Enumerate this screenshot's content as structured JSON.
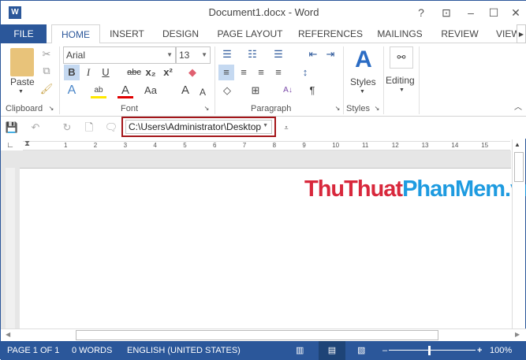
{
  "window": {
    "title": "Document1.docx - Word",
    "app_icon": "W"
  },
  "tabs": [
    {
      "label": "FILE"
    },
    {
      "label": "HOME"
    },
    {
      "label": "INSERT"
    },
    {
      "label": "DESIGN"
    },
    {
      "label": "PAGE LAYOUT"
    },
    {
      "label": "REFERENCES"
    },
    {
      "label": "MAILINGS"
    },
    {
      "label": "REVIEW"
    },
    {
      "label": "VIEW"
    }
  ],
  "ribbon": {
    "clipboard": {
      "label": "Clipboard",
      "paste": "Paste"
    },
    "font": {
      "label": "Font",
      "name": "Arial",
      "size": "13",
      "bold": "B",
      "italic": "I",
      "underline": "U",
      "strike": "abc",
      "sub": "x₂",
      "sup": "x²",
      "case": "Aa",
      "grow": "A",
      "shrink": "A",
      "effects": "A",
      "color": "A",
      "highlight": "ab"
    },
    "paragraph": {
      "label": "Paragraph",
      "pilcrow": "¶"
    },
    "styles": {
      "label": "Styles",
      "button": "Styles"
    },
    "editing": {
      "button": "Editing"
    }
  },
  "qat": {
    "path": "C:\\Users\\Administrator\\Desktop"
  },
  "ruler": {
    "ticks": [
      "1",
      "2",
      "3",
      "4",
      "5",
      "6",
      "7",
      "8",
      "9",
      "10",
      "11",
      "12",
      "13",
      "14",
      "15"
    ]
  },
  "watermark": {
    "part1": "ThuThuat",
    "part2": "PhanMem.vn"
  },
  "status": {
    "page": "PAGE 1 OF 1",
    "words": "0 WORDS",
    "language": "ENGLISH (UNITED STATES)",
    "zoom": "100%"
  },
  "colors": {
    "accent": "#2b579a",
    "highlight_box": "#a4161a",
    "wm_red": "#d8283c",
    "wm_blue": "#1e9be0"
  }
}
